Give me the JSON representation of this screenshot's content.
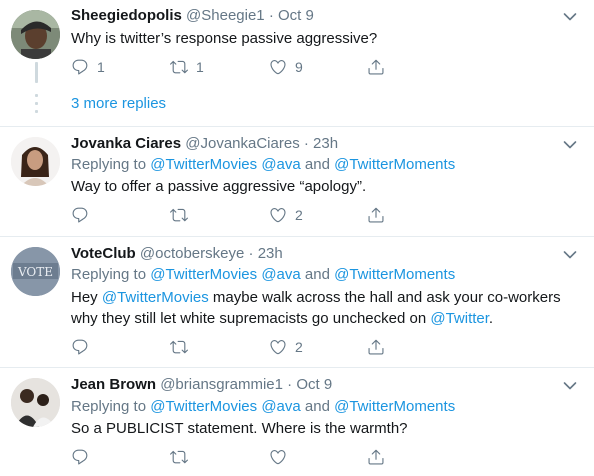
{
  "tweets": [
    {
      "name": "Sheegiedopolis",
      "handle": "@Sheegie1",
      "sep": " · ",
      "time": "Oct 9",
      "text": "Why is twitter’s response passive aggressive?",
      "reply_count": "1",
      "retweet_count": "1",
      "like_count": "9"
    },
    {
      "name": "Jovanka Ciares",
      "handle": "@JovankaCiares",
      "sep": " · ",
      "time": "23h",
      "replying_prefix": "Replying to ",
      "mention1": "@TwitterMovies",
      "mention2": "@ava",
      "and": " and ",
      "mention3": "@TwitterMoments",
      "text": "Way to offer a passive aggressive “apology”.",
      "like_count": "2"
    },
    {
      "name": "VoteClub",
      "handle": "@octoberskeye",
      "sep": " · ",
      "time": "23h",
      "avatar_text": "VOTE",
      "replying_prefix": "Replying to ",
      "mention1": "@TwitterMovies",
      "mention2": "@ava",
      "and": " and ",
      "mention3": "@TwitterMoments",
      "text_a": "Hey ",
      "text_link1": "@TwitterMovies",
      "text_b": " maybe walk across the hall and ask your co-workers",
      "text_c": "why they still let white supremacists go unchecked on ",
      "text_link2": "@Twitter",
      "text_d": ".",
      "like_count": "2"
    },
    {
      "name": "Jean Brown",
      "handle": "@briansgrammie1",
      "sep": " · ",
      "time": "Oct 9",
      "replying_prefix": "Replying to ",
      "mention1": "@TwitterMovies",
      "mention2": "@ava",
      "and": " and ",
      "mention3": "@TwitterMoments",
      "text": "So a PUBLICIST statement.  Where is the warmth?"
    }
  ],
  "more_replies": "3 more replies",
  "icons": [
    "reply-icon",
    "retweet-icon",
    "like-icon",
    "share-icon",
    "chevron-down-icon"
  ],
  "colors": {
    "link": "#1b95e0",
    "meta": "#657786",
    "divider": "#e6ecf0"
  }
}
